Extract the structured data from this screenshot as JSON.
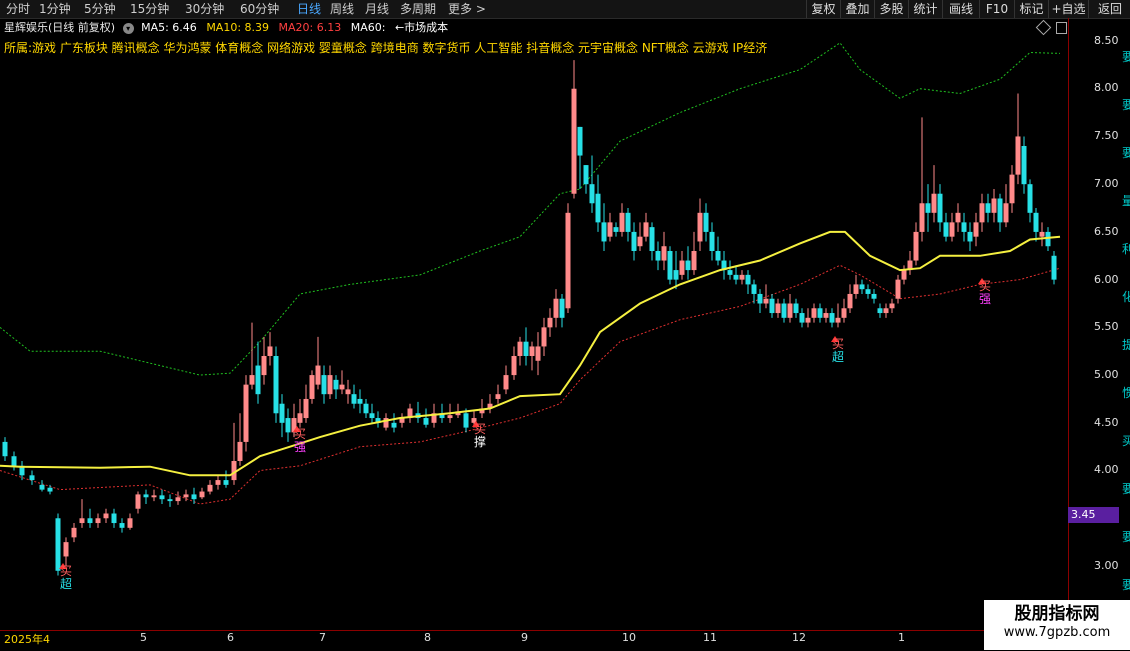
{
  "toolbar": {
    "tabs": [
      "分时",
      "1分钟",
      "5分钟",
      "15分钟",
      "30分钟",
      "60分钟",
      "日线",
      "周线",
      "月线",
      "多周期",
      "更多 >"
    ],
    "active_tab": "日线",
    "right_buttons": [
      "复权",
      "叠加",
      "多股",
      "统计",
      "画线",
      "F10",
      "标记",
      "+自选",
      "返回"
    ]
  },
  "header": {
    "stock_name": "星辉娱乐(日线 前复权)",
    "ma5": "MA5: 6.46",
    "ma10": "MA10: 8.39",
    "ma20": "MA20: 6.13",
    "ma60": "MA60:",
    "cost": "←市场成本",
    "colors": {
      "ma5": "#ffffff",
      "ma10": "#ffd700",
      "ma20": "#ff4040",
      "ma60": "#ffffff"
    }
  },
  "concepts": "所属:游戏 广东板块 腾讯概念 华为鸿蒙 体育概念 网络游戏 婴童概念 跨境电商 数字货币 人工智能 抖音概念 元宇宙概念 NFT概念 云游戏 IP经济",
  "yaxis": {
    "ticks": [
      "8.50",
      "8.00",
      "7.50",
      "7.00",
      "6.50",
      "6.00",
      "5.50",
      "5.00",
      "4.50",
      "4.00",
      "3.00"
    ],
    "partial": [
      "要",
      "要",
      "要",
      "量",
      "利",
      "化",
      "提",
      "惯",
      "买",
      "要",
      "要",
      "要"
    ],
    "current_price": "3.45"
  },
  "xaxis": {
    "labels": [
      "2025年4",
      "5",
      "6",
      "7",
      "8",
      "9",
      "10",
      "11",
      "12",
      "1"
    ]
  },
  "signals": [
    {
      "top": "买",
      "bottom": "超"
    },
    {
      "top": "买",
      "bottom": "强"
    },
    {
      "top": "买",
      "bottom": "撑"
    },
    {
      "top": "买",
      "bottom": "超"
    },
    {
      "top": "买",
      "bottom": "强"
    }
  ],
  "watermark": {
    "line1": "股朋指标网",
    "line2": "www.7gpzb.com"
  },
  "colors": {
    "up": "#ff8a8a",
    "down": "#27e0e6",
    "ma_line": "#f5f040",
    "upper_band": "#20c020",
    "lower_band": "#e03030",
    "axis": "#8b0000"
  },
  "chart_data": {
    "type": "candlestick",
    "ylim": [
      2.8,
      8.6
    ],
    "ma_line": [
      [
        0,
        4.05
      ],
      [
        20,
        4.04
      ],
      [
        100,
        4.03
      ],
      [
        150,
        4.04
      ],
      [
        190,
        3.95
      ],
      [
        230,
        3.95
      ],
      [
        260,
        4.15
      ],
      [
        290,
        4.25
      ],
      [
        320,
        4.35
      ],
      [
        360,
        4.47
      ],
      [
        400,
        4.55
      ],
      [
        450,
        4.6
      ],
      [
        490,
        4.65
      ],
      [
        520,
        4.78
      ],
      [
        560,
        4.8
      ],
      [
        580,
        5.1
      ],
      [
        600,
        5.45
      ],
      [
        640,
        5.75
      ],
      [
        680,
        5.95
      ],
      [
        720,
        6.1
      ],
      [
        760,
        6.2
      ],
      [
        800,
        6.38
      ],
      [
        830,
        6.5
      ],
      [
        845,
        6.5
      ],
      [
        870,
        6.25
      ],
      [
        900,
        6.1
      ],
      [
        920,
        6.12
      ],
      [
        940,
        6.25
      ],
      [
        980,
        6.25
      ],
      [
        1010,
        6.3
      ],
      [
        1030,
        6.42
      ],
      [
        1060,
        6.45
      ]
    ],
    "upper_band": [
      [
        0,
        5.5
      ],
      [
        30,
        5.25
      ],
      [
        100,
        5.25
      ],
      [
        200,
        5.0
      ],
      [
        230,
        5.02
      ],
      [
        260,
        5.35
      ],
      [
        300,
        5.85
      ],
      [
        350,
        5.95
      ],
      [
        420,
        6.05
      ],
      [
        480,
        6.3
      ],
      [
        520,
        6.45
      ],
      [
        560,
        6.9
      ],
      [
        580,
        6.95
      ],
      [
        620,
        7.45
      ],
      [
        680,
        7.75
      ],
      [
        740,
        8.0
      ],
      [
        800,
        8.2
      ],
      [
        840,
        8.48
      ],
      [
        860,
        8.2
      ],
      [
        900,
        7.9
      ],
      [
        920,
        8.0
      ],
      [
        960,
        7.95
      ],
      [
        1000,
        8.1
      ],
      [
        1030,
        8.38
      ],
      [
        1060,
        8.37
      ]
    ],
    "lower_band": [
      [
        0,
        4.0
      ],
      [
        60,
        3.8
      ],
      [
        150,
        3.85
      ],
      [
        200,
        3.65
      ],
      [
        230,
        3.7
      ],
      [
        260,
        4.0
      ],
      [
        300,
        4.05
      ],
      [
        360,
        4.25
      ],
      [
        420,
        4.3
      ],
      [
        470,
        4.42
      ],
      [
        520,
        4.55
      ],
      [
        560,
        4.7
      ],
      [
        580,
        4.95
      ],
      [
        620,
        5.35
      ],
      [
        680,
        5.58
      ],
      [
        740,
        5.72
      ],
      [
        800,
        5.95
      ],
      [
        840,
        6.15
      ],
      [
        860,
        6.05
      ],
      [
        900,
        5.8
      ],
      [
        940,
        5.85
      ],
      [
        980,
        5.95
      ],
      [
        1020,
        6.0
      ],
      [
        1060,
        6.12
      ]
    ],
    "candles": [
      [
        5,
        4.3,
        4.15,
        4.35,
        4.1
      ],
      [
        14,
        4.15,
        4.05,
        4.2,
        4.0
      ],
      [
        22,
        4.05,
        3.95,
        4.1,
        3.9
      ],
      [
        32,
        3.95,
        3.9,
        4.0,
        3.85
      ],
      [
        42,
        3.85,
        3.8,
        3.9,
        3.78
      ],
      [
        50,
        3.82,
        3.78,
        3.85,
        3.75
      ],
      [
        58,
        3.5,
        2.95,
        3.55,
        2.9
      ],
      [
        66,
        3.1,
        3.25,
        3.3,
        3.0
      ],
      [
        74,
        3.3,
        3.4,
        3.45,
        3.25
      ],
      [
        82,
        3.45,
        3.5,
        3.7,
        3.4
      ],
      [
        90,
        3.5,
        3.45,
        3.6,
        3.4
      ],
      [
        98,
        3.45,
        3.5,
        3.55,
        3.4
      ],
      [
        106,
        3.5,
        3.55,
        3.6,
        3.45
      ],
      [
        114,
        3.55,
        3.45,
        3.6,
        3.4
      ],
      [
        122,
        3.45,
        3.4,
        3.5,
        3.35
      ],
      [
        130,
        3.4,
        3.5,
        3.55,
        3.38
      ],
      [
        138,
        3.6,
        3.75,
        3.78,
        3.55
      ],
      [
        146,
        3.75,
        3.72,
        3.8,
        3.65
      ],
      [
        154,
        3.72,
        3.74,
        3.8,
        3.68
      ],
      [
        162,
        3.74,
        3.7,
        3.8,
        3.65
      ],
      [
        170,
        3.7,
        3.68,
        3.75,
        3.62
      ],
      [
        178,
        3.68,
        3.72,
        3.78,
        3.64
      ],
      [
        186,
        3.72,
        3.75,
        3.8,
        3.68
      ],
      [
        194,
        3.75,
        3.7,
        3.82,
        3.65
      ],
      [
        202,
        3.72,
        3.78,
        3.82,
        3.7
      ],
      [
        210,
        3.78,
        3.85,
        3.9,
        3.75
      ],
      [
        218,
        3.85,
        3.9,
        3.95,
        3.8
      ],
      [
        226,
        3.9,
        3.85,
        4.0,
        3.82
      ],
      [
        234,
        3.9,
        4.1,
        4.5,
        3.85
      ],
      [
        240,
        4.1,
        4.3,
        4.6,
        4.05
      ],
      [
        246,
        4.3,
        4.9,
        5.0,
        4.2
      ],
      [
        252,
        4.9,
        5.0,
        5.55,
        4.85
      ],
      [
        258,
        5.1,
        4.8,
        5.35,
        4.7
      ],
      [
        264,
        5.0,
        5.2,
        5.4,
        4.9
      ],
      [
        270,
        5.2,
        5.3,
        5.45,
        5.1
      ],
      [
        276,
        5.2,
        4.6,
        5.3,
        4.5
      ],
      [
        282,
        4.7,
        4.5,
        4.8,
        4.35
      ],
      [
        288,
        4.55,
        4.4,
        4.65,
        4.3
      ],
      [
        294,
        4.4,
        4.55,
        4.7,
        4.35
      ],
      [
        300,
        4.5,
        4.6,
        4.75,
        4.45
      ],
      [
        306,
        4.55,
        4.75,
        4.9,
        4.5
      ],
      [
        312,
        4.75,
        5.0,
        5.05,
        4.7
      ],
      [
        318,
        4.9,
        5.1,
        5.4,
        4.85
      ],
      [
        324,
        5.0,
        4.8,
        5.1,
        4.7
      ],
      [
        330,
        4.8,
        5.0,
        5.1,
        4.75
      ],
      [
        336,
        4.95,
        4.85,
        5.0,
        4.75
      ],
      [
        342,
        4.85,
        4.9,
        5.05,
        4.8
      ],
      [
        348,
        4.8,
        4.85,
        4.95,
        4.7
      ],
      [
        354,
        4.8,
        4.7,
        4.9,
        4.65
      ],
      [
        360,
        4.75,
        4.7,
        4.85,
        4.6
      ],
      [
        366,
        4.7,
        4.6,
        4.75,
        4.55
      ],
      [
        372,
        4.6,
        4.55,
        4.7,
        4.5
      ],
      [
        378,
        4.55,
        4.5,
        4.62,
        4.45
      ],
      [
        386,
        4.45,
        4.55,
        4.6,
        4.42
      ],
      [
        394,
        4.5,
        4.45,
        4.6,
        4.4
      ],
      [
        402,
        4.5,
        4.55,
        4.6,
        4.45
      ],
      [
        410,
        4.55,
        4.65,
        4.7,
        4.5
      ],
      [
        418,
        4.6,
        4.55,
        4.72,
        4.5
      ],
      [
        426,
        4.55,
        4.48,
        4.65,
        4.45
      ],
      [
        434,
        4.5,
        4.6,
        4.7,
        4.45
      ],
      [
        442,
        4.6,
        4.55,
        4.7,
        4.5
      ],
      [
        450,
        4.55,
        4.58,
        4.7,
        4.5
      ],
      [
        458,
        4.58,
        4.62,
        4.7,
        4.55
      ],
      [
        466,
        4.6,
        4.45,
        4.65,
        4.4
      ],
      [
        474,
        4.5,
        4.55,
        4.62,
        4.45
      ],
      [
        482,
        4.6,
        4.65,
        4.75,
        4.55
      ],
      [
        490,
        4.65,
        4.7,
        4.8,
        4.6
      ],
      [
        498,
        4.75,
        4.8,
        4.9,
        4.7
      ],
      [
        506,
        4.85,
        5.0,
        5.1,
        4.8
      ],
      [
        514,
        5.0,
        5.2,
        5.3,
        4.95
      ],
      [
        520,
        5.2,
        5.35,
        5.4,
        5.1
      ],
      [
        526,
        5.35,
        5.2,
        5.5,
        5.1
      ],
      [
        532,
        5.2,
        5.3,
        5.35,
        5.05
      ],
      [
        538,
        5.15,
        5.3,
        5.45,
        5.0
      ],
      [
        544,
        5.3,
        5.5,
        5.6,
        5.2
      ],
      [
        550,
        5.5,
        5.6,
        5.7,
        5.4
      ],
      [
        556,
        5.6,
        5.8,
        5.9,
        5.5
      ],
      [
        562,
        5.8,
        5.6,
        5.85,
        5.5
      ],
      [
        568,
        5.7,
        6.7,
        6.8,
        5.65
      ],
      [
        574,
        6.9,
        8.0,
        8.3,
        6.85
      ],
      [
        580,
        7.6,
        7.3,
        7.6,
        6.95
      ],
      [
        586,
        7.2,
        7.0,
        7.2,
        6.9
      ],
      [
        592,
        7.0,
        6.8,
        7.3,
        6.7
      ],
      [
        598,
        6.9,
        6.6,
        7.1,
        6.5
      ],
      [
        604,
        6.6,
        6.4,
        6.8,
        6.3
      ],
      [
        610,
        6.45,
        6.6,
        6.7,
        6.4
      ],
      [
        616,
        6.55,
        6.5,
        6.6,
        6.45
      ],
      [
        622,
        6.5,
        6.7,
        6.8,
        6.45
      ],
      [
        628,
        6.7,
        6.5,
        6.75,
        6.4
      ],
      [
        634,
        6.5,
        6.3,
        6.6,
        6.2
      ],
      [
        640,
        6.35,
        6.45,
        6.6,
        6.3
      ],
      [
        646,
        6.45,
        6.6,
        6.7,
        6.4
      ],
      [
        652,
        6.55,
        6.3,
        6.6,
        6.2
      ],
      [
        658,
        6.3,
        6.2,
        6.4,
        6.1
      ],
      [
        664,
        6.2,
        6.35,
        6.5,
        6.1
      ],
      [
        670,
        6.3,
        6.0,
        6.35,
        5.95
      ],
      [
        676,
        6.1,
        6.0,
        6.3,
        5.9
      ],
      [
        682,
        6.05,
        6.2,
        6.3,
        6.0
      ],
      [
        688,
        6.2,
        6.1,
        6.35,
        6.0
      ],
      [
        694,
        6.1,
        6.3,
        6.5,
        6.05
      ],
      [
        700,
        6.4,
        6.7,
        6.85,
        6.3
      ],
      [
        706,
        6.7,
        6.5,
        6.8,
        6.4
      ],
      [
        712,
        6.5,
        6.3,
        6.6,
        6.2
      ],
      [
        718,
        6.3,
        6.2,
        6.45,
        6.15
      ],
      [
        724,
        6.2,
        6.1,
        6.3,
        6.0
      ],
      [
        730,
        6.1,
        6.05,
        6.2,
        6.0
      ],
      [
        736,
        6.05,
        6.0,
        6.15,
        5.95
      ],
      [
        742,
        6.0,
        6.05,
        6.1,
        5.95
      ],
      [
        748,
        6.05,
        5.95,
        6.1,
        5.85
      ],
      [
        754,
        5.95,
        5.85,
        6.0,
        5.75
      ],
      [
        760,
        5.85,
        5.75,
        5.9,
        5.65
      ],
      [
        766,
        5.75,
        5.8,
        5.95,
        5.7
      ],
      [
        772,
        5.8,
        5.65,
        5.85,
        5.6
      ],
      [
        778,
        5.65,
        5.75,
        5.8,
        5.6
      ],
      [
        784,
        5.75,
        5.6,
        5.8,
        5.55
      ],
      [
        790,
        5.6,
        5.75,
        5.85,
        5.55
      ],
      [
        796,
        5.75,
        5.65,
        5.8,
        5.6
      ],
      [
        802,
        5.65,
        5.55,
        5.7,
        5.5
      ],
      [
        808,
        5.55,
        5.6,
        5.7,
        5.5
      ],
      [
        814,
        5.6,
        5.7,
        5.75,
        5.55
      ],
      [
        820,
        5.7,
        5.6,
        5.75,
        5.55
      ],
      [
        826,
        5.6,
        5.65,
        5.7,
        5.55
      ],
      [
        832,
        5.65,
        5.55,
        5.7,
        5.5
      ],
      [
        838,
        5.55,
        5.6,
        5.75,
        5.5
      ],
      [
        844,
        5.6,
        5.7,
        5.8,
        5.55
      ],
      [
        850,
        5.7,
        5.85,
        5.95,
        5.65
      ],
      [
        856,
        5.85,
        5.95,
        6.05,
        5.8
      ],
      [
        862,
        5.95,
        5.9,
        6.0,
        5.85
      ],
      [
        868,
        5.9,
        5.85,
        5.95,
        5.8
      ],
      [
        874,
        5.85,
        5.8,
        5.9,
        5.75
      ],
      [
        880,
        5.7,
        5.65,
        5.75,
        5.6
      ],
      [
        886,
        5.65,
        5.7,
        5.75,
        5.6
      ],
      [
        892,
        5.7,
        5.75,
        5.8,
        5.65
      ],
      [
        898,
        5.8,
        6.0,
        6.05,
        5.75
      ],
      [
        904,
        6.0,
        6.1,
        6.15,
        5.95
      ],
      [
        910,
        6.1,
        6.2,
        6.3,
        6.05
      ],
      [
        916,
        6.2,
        6.5,
        6.6,
        6.15
      ],
      [
        922,
        6.5,
        6.8,
        7.7,
        6.4
      ],
      [
        928,
        6.8,
        6.7,
        7.0,
        6.5
      ],
      [
        934,
        6.7,
        6.9,
        7.2,
        6.6
      ],
      [
        940,
        6.9,
        6.6,
        7.0,
        6.5
      ],
      [
        946,
        6.6,
        6.45,
        6.7,
        6.4
      ],
      [
        952,
        6.45,
        6.6,
        6.7,
        6.4
      ],
      [
        958,
        6.6,
        6.7,
        6.8,
        6.5
      ],
      [
        964,
        6.6,
        6.5,
        6.7,
        6.4
      ],
      [
        970,
        6.5,
        6.4,
        6.6,
        6.3
      ],
      [
        976,
        6.45,
        6.6,
        6.7,
        6.35
      ],
      [
        982,
        6.6,
        6.8,
        6.9,
        6.5
      ],
      [
        988,
        6.8,
        6.7,
        6.9,
        6.6
      ],
      [
        994,
        6.7,
        6.85,
        6.95,
        6.6
      ],
      [
        1000,
        6.85,
        6.6,
        6.9,
        6.5
      ],
      [
        1006,
        6.6,
        6.8,
        7.0,
        6.55
      ],
      [
        1012,
        6.8,
        7.1,
        7.2,
        6.7
      ],
      [
        1018,
        7.1,
        7.5,
        7.95,
        7.0
      ],
      [
        1024,
        7.4,
        7.0,
        7.5,
        6.9
      ],
      [
        1030,
        7.0,
        6.7,
        7.05,
        6.6
      ],
      [
        1036,
        6.7,
        6.5,
        6.75,
        6.4
      ],
      [
        1042,
        6.45,
        6.5,
        6.6,
        6.35
      ],
      [
        1048,
        6.5,
        6.35,
        6.55,
        6.3
      ],
      [
        1054,
        6.25,
        6.0,
        6.3,
        5.95
      ]
    ]
  }
}
